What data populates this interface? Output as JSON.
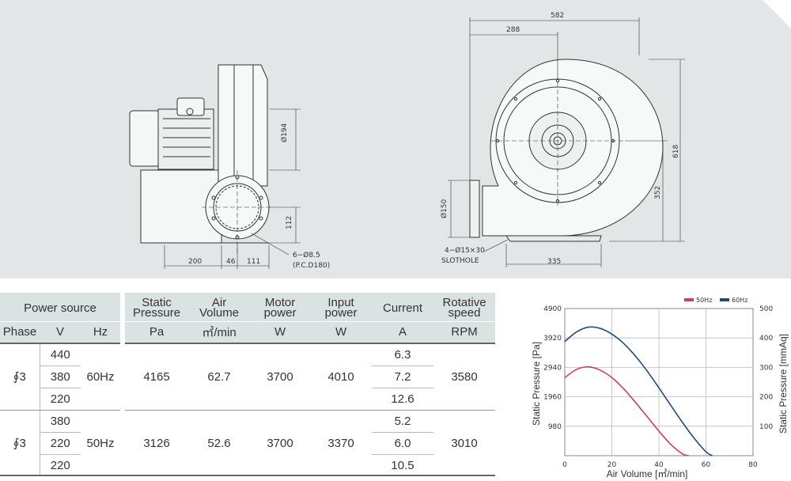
{
  "drawing": {
    "side_dims": {
      "d194": "Ø194",
      "d112": "112",
      "d200": "200",
      "d46": "46",
      "d111": "111",
      "holes": "6−Ø8.5",
      "pcd": "(P.C.D180)"
    },
    "front_dims": {
      "d582": "582",
      "d288": "288",
      "d618": "618",
      "d352": "352",
      "d150": "Ø150",
      "slot": "4−Ø15×30",
      "slothole": "SLOTHOLE",
      "d335": "335"
    }
  },
  "table": {
    "headers": {
      "power_source": "Power source",
      "static_pressure": [
        "Static",
        "Pressure"
      ],
      "air_volume": [
        "Air",
        "Volume"
      ],
      "motor_power": [
        "Motor",
        "power"
      ],
      "input_power": [
        "Input",
        "power"
      ],
      "current": "Current",
      "rotative_speed": [
        "Rotative",
        "speed"
      ]
    },
    "subheaders": {
      "phase": "Phase",
      "v": "V",
      "hz": "Hz",
      "pa": "Pa",
      "m3min": "㎥/min",
      "w1": "W",
      "w2": "W",
      "a": "A",
      "rpm": "RPM"
    },
    "rows": [
      {
        "phase": "∮3",
        "voltages": [
          "440",
          "380",
          "220"
        ],
        "hz": "60Hz",
        "pa": "4165",
        "m3min": "62.7",
        "motor_w": "3700",
        "input_w": "4010",
        "currents": [
          "6.3",
          "7.2",
          "12.6"
        ],
        "rpm": "3580"
      },
      {
        "phase": "∮3",
        "voltages": [
          "380",
          "220",
          "220"
        ],
        "hz": "50Hz",
        "pa": "3126",
        "m3min": "52.6",
        "motor_w": "3700",
        "input_w": "3370",
        "currents": [
          "5.2",
          "6.0",
          "10.5"
        ],
        "rpm": "3010"
      }
    ]
  },
  "chart_data": {
    "type": "line",
    "xlabel": "Air Volume [㎥/min]",
    "ylabel": "Static Pressure [Pa]",
    "y2label": "Static Pressure [mmAq]",
    "xlim": [
      0,
      80
    ],
    "ylim": [
      0,
      4900
    ],
    "y2lim": [
      0,
      500
    ],
    "x_ticks": [
      "0",
      "20",
      "40",
      "60",
      "80"
    ],
    "y_ticks": [
      "980",
      "1960",
      "2940",
      "3920",
      "4900"
    ],
    "y2_ticks": [
      "100",
      "200",
      "300",
      "400",
      "500"
    ],
    "legend_position": "top-right",
    "grid": true,
    "series": [
      {
        "name": "50Hz",
        "color": "#c8434f",
        "x": [
          0,
          5,
          10,
          15,
          20,
          25,
          30,
          35,
          40,
          45,
          50,
          52.6
        ],
        "y": [
          2600,
          2870,
          2960,
          2850,
          2600,
          2230,
          1780,
          1300,
          820,
          380,
          60,
          0
        ]
      },
      {
        "name": "60Hz",
        "color": "#1f4a7a",
        "x": [
          0,
          5,
          10,
          15,
          20,
          25,
          30,
          35,
          40,
          45,
          50,
          55,
          60,
          62.7
        ],
        "y": [
          3800,
          4120,
          4280,
          4240,
          4050,
          3740,
          3320,
          2820,
          2260,
          1680,
          1110,
          580,
          130,
          0
        ]
      }
    ]
  }
}
